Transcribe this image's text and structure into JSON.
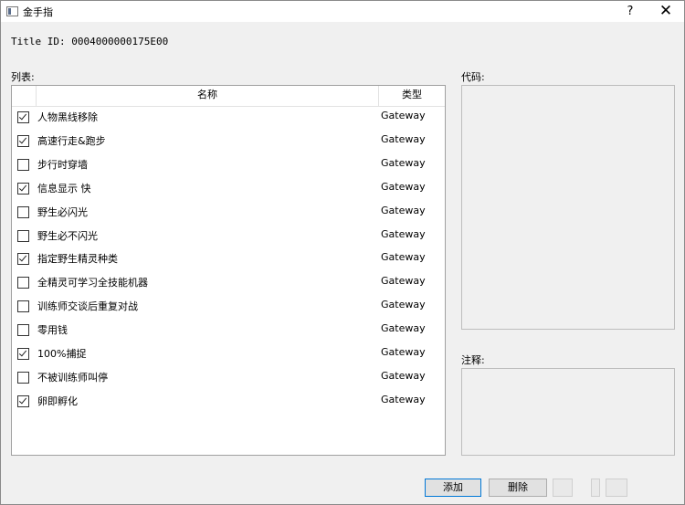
{
  "window": {
    "title": "金手指",
    "help": "?",
    "close": "✕"
  },
  "title_id": "Title ID: 0004000000175E00",
  "labels": {
    "list": "列表:",
    "code": "代码:",
    "note": "注释:"
  },
  "table": {
    "headers": {
      "name": "名称",
      "type": "类型"
    },
    "rows": [
      {
        "name": "人物黑线移除",
        "type": "Gateway",
        "checked": true
      },
      {
        "name": "高速行走&跑步",
        "type": "Gateway",
        "checked": true
      },
      {
        "name": "步行时穿墙",
        "type": "Gateway",
        "checked": false
      },
      {
        "name": "信息显示  快",
        "type": "Gateway",
        "checked": true
      },
      {
        "name": "野生必闪光",
        "type": "Gateway",
        "checked": false
      },
      {
        "name": "野生必不闪光",
        "type": "Gateway",
        "checked": false
      },
      {
        "name": "指定野生精灵种类",
        "type": "Gateway",
        "checked": true
      },
      {
        "name": "全精灵可学习全技能机器",
        "type": "Gateway",
        "checked": false
      },
      {
        "name": "训练师交谈后重复对战",
        "type": "Gateway",
        "checked": false
      },
      {
        "name": "零用钱",
        "type": "Gateway",
        "checked": false
      },
      {
        "name": "100%捕捉",
        "type": "Gateway",
        "checked": true
      },
      {
        "name": "不被训练师叫停",
        "type": "Gateway",
        "checked": false
      },
      {
        "name": "卵即孵化",
        "type": "Gateway",
        "checked": true
      }
    ]
  },
  "buttons": {
    "add": "添加",
    "delete": "删除"
  }
}
